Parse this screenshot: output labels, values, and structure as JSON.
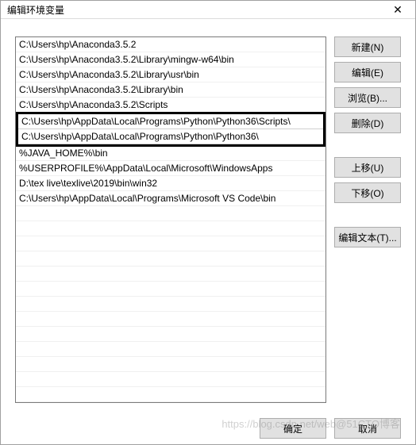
{
  "titlebar": {
    "title": "编辑环境变量",
    "close_label": "✕"
  },
  "list": {
    "items": [
      "C:\\Users\\hp\\Anaconda3.5.2",
      "C:\\Users\\hp\\Anaconda3.5.2\\Library\\mingw-w64\\bin",
      "C:\\Users\\hp\\Anaconda3.5.2\\Library\\usr\\bin",
      "C:\\Users\\hp\\Anaconda3.5.2\\Library\\bin",
      "C:\\Users\\hp\\Anaconda3.5.2\\Scripts"
    ],
    "highlighted": [
      "C:\\Users\\hp\\AppData\\Local\\Programs\\Python\\Python36\\Scripts\\",
      "C:\\Users\\hp\\AppData\\Local\\Programs\\Python\\Python36\\"
    ],
    "items_after": [
      "%JAVA_HOME%\\bin",
      "%USERPROFILE%\\AppData\\Local\\Microsoft\\WindowsApps",
      "D:\\tex live\\texlive\\2019\\bin\\win32",
      "C:\\Users\\hp\\AppData\\Local\\Programs\\Microsoft VS Code\\bin"
    ]
  },
  "buttons": {
    "new": "新建(N)",
    "edit": "编辑(E)",
    "browse": "浏览(B)...",
    "delete": "删除(D)",
    "moveup": "上移(U)",
    "movedown": "下移(O)",
    "edittext": "编辑文本(T)..."
  },
  "footer": {
    "ok": "确定",
    "cancel": "取消"
  },
  "watermark": "https://blog.csdn.net/web@51CTO博客"
}
